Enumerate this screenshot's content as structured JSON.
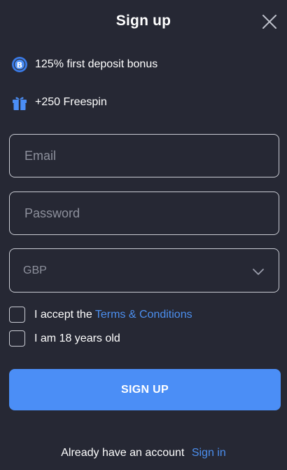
{
  "modal": {
    "title": "Sign up",
    "close_icon": "close-icon"
  },
  "bonuses": [
    {
      "icon": "bitcoin-coin-icon",
      "text": "125% first deposit bonus"
    },
    {
      "icon": "gift-icon",
      "text": "+250 Freespin"
    }
  ],
  "form": {
    "email_placeholder": "Email",
    "password_placeholder": "Password",
    "currency_value": "GBP",
    "currency_icon": "chevron-down-icon"
  },
  "checks": {
    "terms_prefix": "I accept the ",
    "terms_link": "Terms & Conditions",
    "age_text": "I am 18 years old"
  },
  "signup_button": "SIGN UP",
  "footer": {
    "text": "Already have an account",
    "link": "Sign in"
  },
  "colors": {
    "background": "#262834",
    "accent": "#4b8ef6",
    "link": "#4c8fef",
    "border": "#c9cbd3"
  }
}
